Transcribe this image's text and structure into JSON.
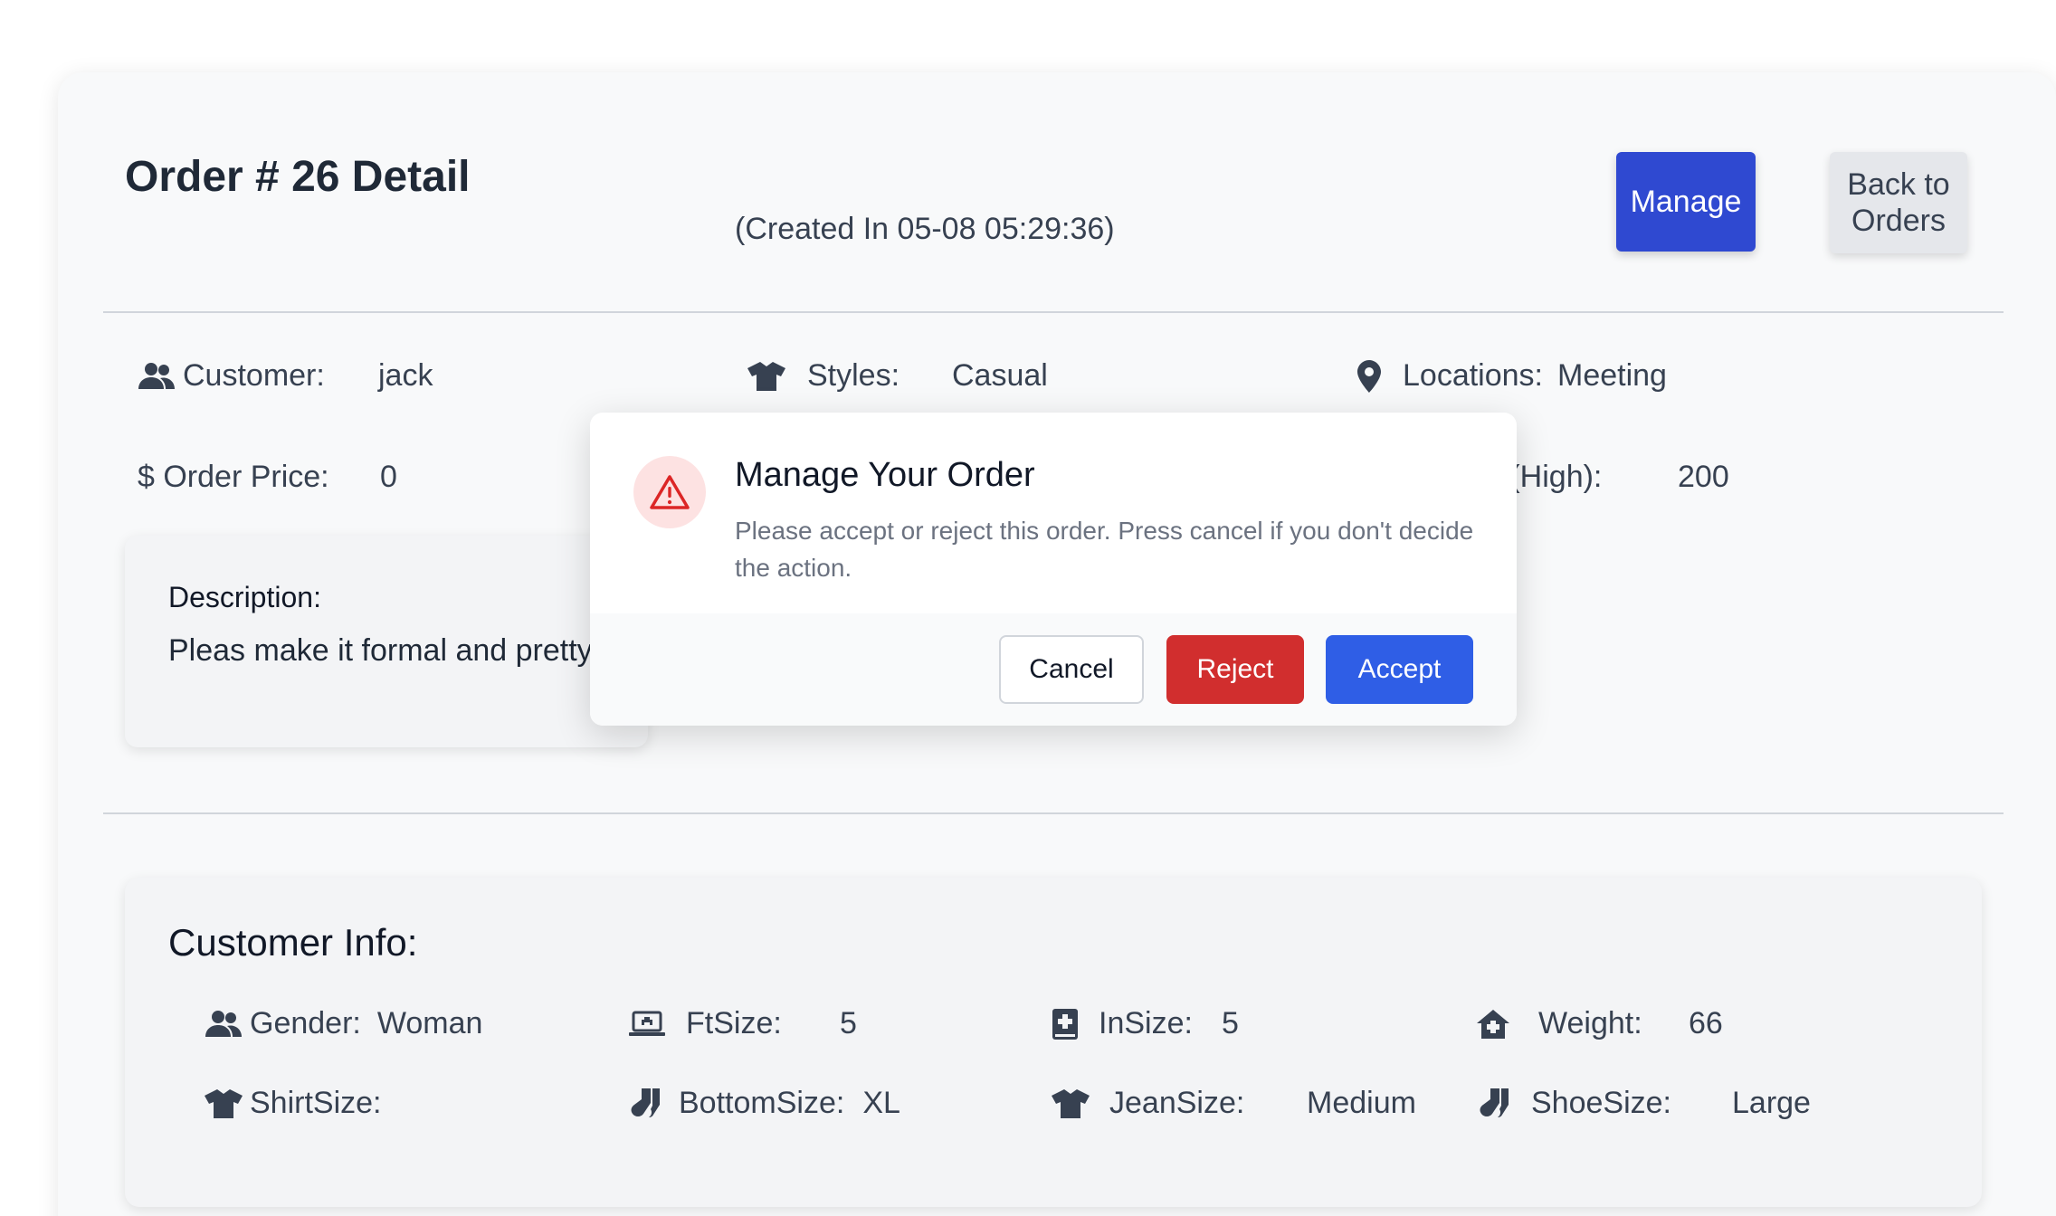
{
  "header": {
    "title": "Order # 26 Detail",
    "created": "(Created In 05-08 05:29:36)",
    "manage_label": "Manage",
    "back_label": "Back to Orders"
  },
  "order": {
    "customer_label": "Customer:",
    "customer_value": "jack",
    "styles_label": "Styles:",
    "styles_value": "Casual",
    "locations_label": "Locations:",
    "locations_value": "Meeting",
    "price_label": "Order Price:",
    "price_value": "0",
    "price_high_label_partial": "e (High):",
    "price_high_value": "200"
  },
  "description": {
    "label": "Description:",
    "text": "Pleas make it formal and pretty"
  },
  "customer_info": {
    "title": "Customer Info:",
    "fields": [
      {
        "label": "Gender:",
        "value": "Woman",
        "icon": "users-icon"
      },
      {
        "label": "FtSize:",
        "value": "5",
        "icon": "laptop-medical-icon"
      },
      {
        "label": "InSize:",
        "value": "5",
        "icon": "book-medical-icon"
      },
      {
        "label": "Weight:",
        "value": "66",
        "icon": "house-medical-icon"
      },
      {
        "label": "ShirtSize:",
        "value": "",
        "icon": "shirt-icon"
      },
      {
        "label": "BottomSize:",
        "value": "XL",
        "icon": "socks-icon"
      },
      {
        "label": "JeanSize:",
        "value": "Medium",
        "icon": "shirt-icon"
      },
      {
        "label": "ShoeSize:",
        "value": "Large",
        "icon": "socks-icon"
      }
    ]
  },
  "modal": {
    "title": "Manage Your Order",
    "body": "Please accept or reject this order. Press cancel if you don't decide the action.",
    "cancel_label": "Cancel",
    "reject_label": "Reject",
    "accept_label": "Accept"
  },
  "colors": {
    "primary": "#2f49d1",
    "accept": "#2f5ee6",
    "reject": "#d12e2e",
    "warning_bg": "#fde2e2",
    "warning_icon": "#dc2626"
  }
}
